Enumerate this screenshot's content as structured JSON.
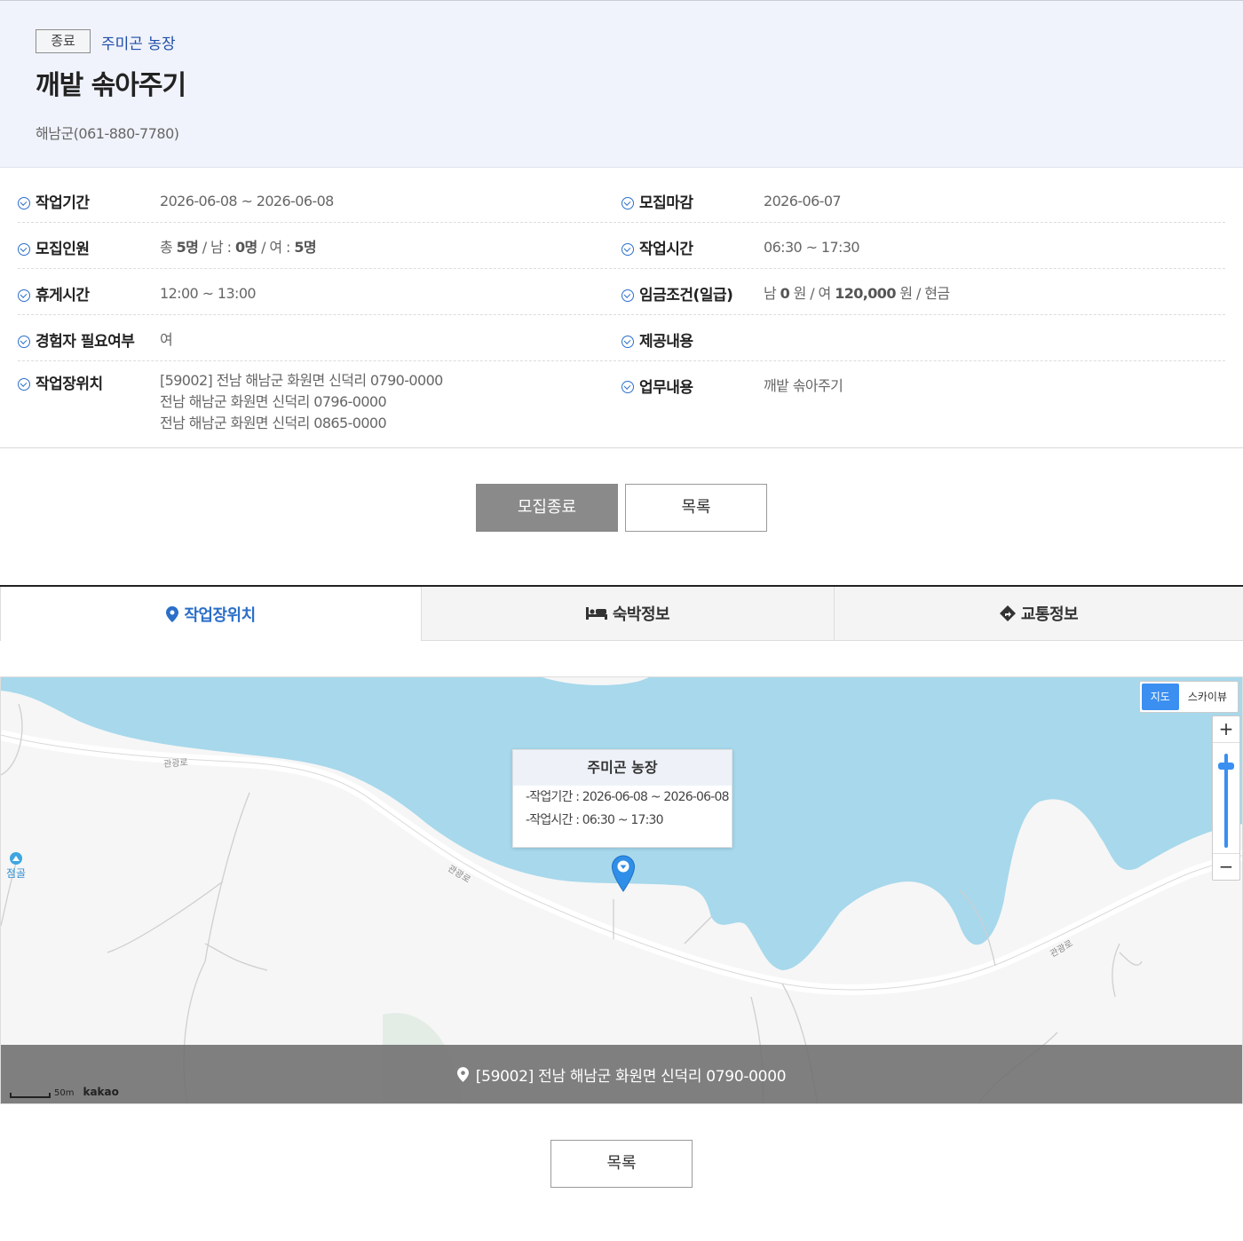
{
  "header": {
    "status_badge": "종료",
    "farm_name": "주미곤 농장",
    "title": "깨밭 솎아주기",
    "contact": "해남군(061-880-7780)"
  },
  "info": {
    "work_period_label": "작업기간",
    "work_period_value": "2026-06-08 ~ 2026-06-08",
    "deadline_label": "모집마감",
    "deadline_value": "2026-06-07",
    "recruits_label": "모집인원",
    "recruits_total_prefix": "총",
    "recruits_total": "5명",
    "recruits_male_prefix": "/ 남 :",
    "recruits_male": "0명",
    "recruits_female_prefix": "/ 여 :",
    "recruits_female": "5명",
    "work_time_label": "작업시간",
    "work_time_value": "06:30 ~ 17:30",
    "break_label": "휴게시간",
    "break_value": "12:00 ~ 13:00",
    "wage_label": "임금조건(일급)",
    "wage_male_prefix": "남",
    "wage_male": "0",
    "wage_mid": "원 / 여",
    "wage_female": "120,000",
    "wage_suffix": "원 / 현금",
    "experience_label": "경험자 필요여부",
    "experience_value": "여",
    "provision_label": "제공내용",
    "provision_value": "",
    "location_label": "작업장위치",
    "location_lines": [
      "[59002] 전남 해남군 화원면 신덕리 0790-0000",
      "전남 해남군 화원면 신덕리 0796-0000",
      "전남 해남군 화원면 신덕리 0865-0000"
    ],
    "duty_label": "업무내용",
    "duty_value": "깨밭 솎아주기"
  },
  "buttons": {
    "closed": "모집종료",
    "list": "목록",
    "list_bottom": "목록"
  },
  "tabs": [
    {
      "label": "작업장위치",
      "icon": "map-pin-icon",
      "active": true
    },
    {
      "label": "숙박정보",
      "icon": "bed-icon",
      "active": false
    },
    {
      "label": "교통정보",
      "icon": "direction-sign-icon",
      "active": false
    }
  ],
  "map": {
    "type_map": "지도",
    "type_skyview": "스카이뷰",
    "zoom_in": "+",
    "zoom_out": "−",
    "popup_title": "주미곤 농장",
    "popup_period": "-작업기간 : 2026-06-08 ~ 2026-06-08",
    "popup_time": "-작업시간 : 06:30 ~ 17:30",
    "place_label": "점골",
    "road_labels": [
      "관광로",
      "관광로",
      "관광로"
    ],
    "address": "[59002] 전남 해남군 화원면 신덕리 0790-0000",
    "scale_text": "50m",
    "provider": "kakao",
    "water_color": "#a7d8ec",
    "land_color": "#f6f6f6",
    "accent_color": "#2b6fc9"
  }
}
